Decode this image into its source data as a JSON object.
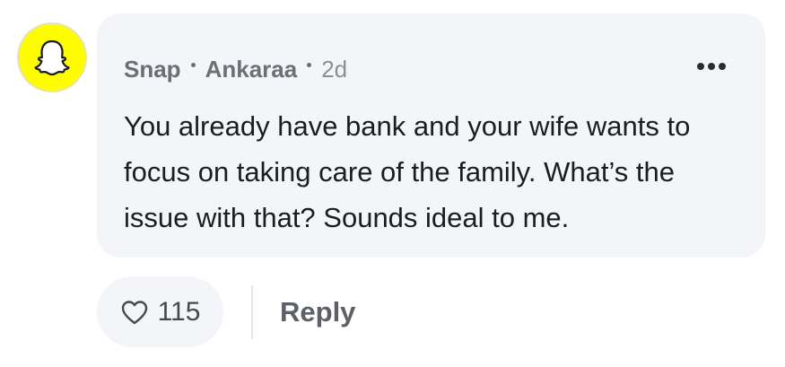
{
  "comment": {
    "author": "Snap",
    "location": "Ankaraa",
    "time": "2d",
    "text": "You already have bank and your wife wants to focus on taking care of the family. What’s the issue with that? Sounds ideal to me.",
    "avatar_icon": "snapchat-ghost-icon",
    "avatar_color": "#FFFC00",
    "more_icon": "more-horizontal-icon"
  },
  "actions": {
    "like_icon": "heart-outline-icon",
    "like_count": "115",
    "reply_label": "Reply"
  }
}
